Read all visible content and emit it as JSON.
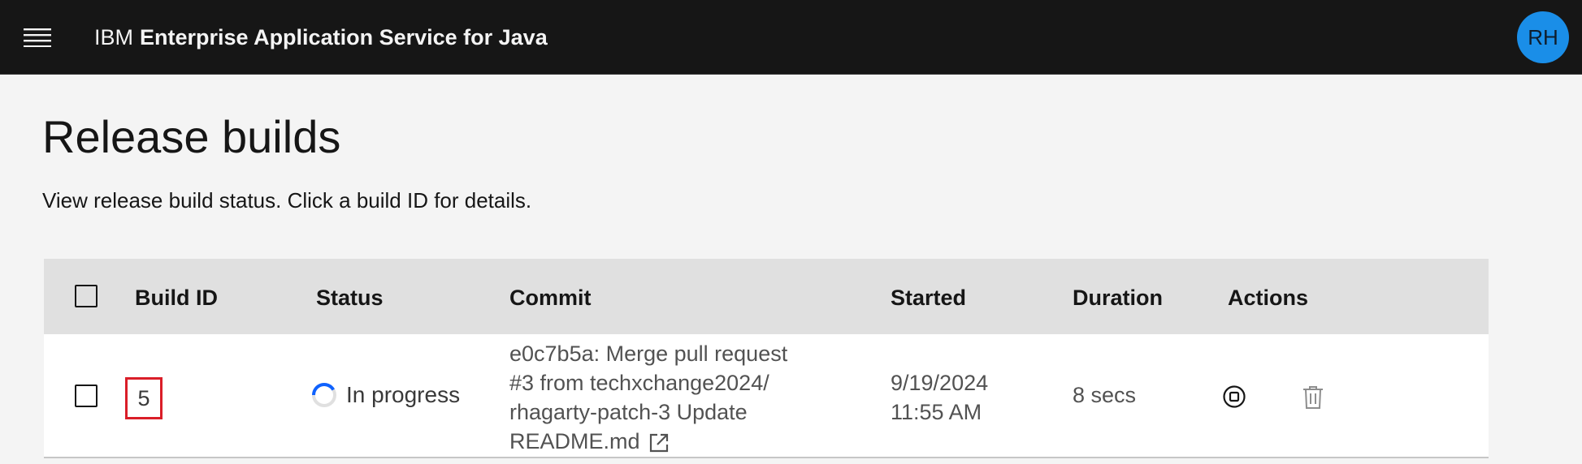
{
  "header": {
    "company": "IBM",
    "product": "Enterprise Application Service for Java",
    "avatar_initials": "RH"
  },
  "page": {
    "title": "Release builds",
    "description": "View release build status. Click a build ID for details."
  },
  "table": {
    "columns": [
      "Build ID",
      "Status",
      "Commit",
      "Started",
      "Duration",
      "Actions"
    ],
    "rows": [
      {
        "build_id": "5",
        "status": "In progress",
        "commit_lines": [
          "e0c7b5a: Merge pull request",
          "#3 from techxchange2024/",
          "rhagarty-patch-3 Update",
          "README.md"
        ],
        "started_lines": [
          "9/19/2024",
          "11:55 AM"
        ],
        "duration": "8 secs",
        "actions": [
          "stop-icon",
          "trash-icon"
        ]
      }
    ]
  },
  "colors": {
    "header_bg": "#161616",
    "page_bg": "#f4f4f4",
    "table_header_bg": "#e0e0e0",
    "avatar_bg": "#1a8ee8",
    "spinner": "#0f62fe",
    "highlight": "#da1e28"
  }
}
